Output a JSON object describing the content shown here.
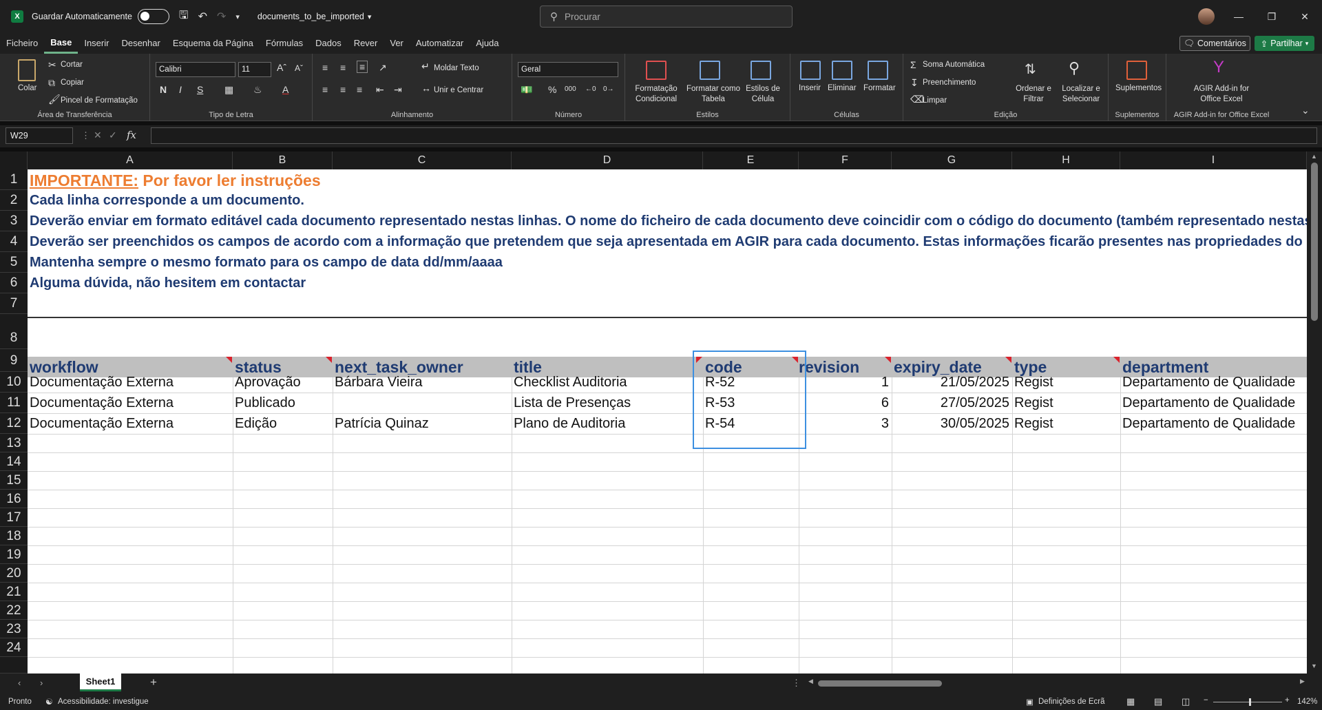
{
  "titlebar": {
    "autosave_label": "Guardar Automaticamente",
    "document_name": "documents_to_be_imported",
    "search_placeholder": "Procurar",
    "window_controls": [
      "minimize-icon",
      "restore-icon",
      "close-icon"
    ]
  },
  "menu": {
    "items": [
      "Ficheiro",
      "Base",
      "Inserir",
      "Desenhar",
      "Esquema da Página",
      "Fórmulas",
      "Dados",
      "Rever",
      "Ver",
      "Automatizar",
      "Ajuda"
    ],
    "active": "Base",
    "comments_label": "Comentários",
    "share_label": "Partilhar"
  },
  "ribbon": {
    "clipboard": {
      "paste": "Colar",
      "cut": "Cortar",
      "copy": "Copiar",
      "format_painter": "Pincel de Formatação",
      "group": "Área de Transferência"
    },
    "font": {
      "family": "Calibri",
      "size": "11",
      "bold": "N",
      "italic": "I",
      "underline": "S",
      "group": "Tipo de Letra"
    },
    "alignment": {
      "wrap": "Moldar Texto",
      "merge": "Unir e Centrar",
      "group": "Alinhamento"
    },
    "number": {
      "format": "Geral",
      "group": "Número"
    },
    "styles": {
      "conditional": "Formatação Condicional",
      "table": "Formatar como Tabela",
      "cell": "Estilos de Célula",
      "group": "Estilos"
    },
    "cells": {
      "insert": "Inserir",
      "delete": "Eliminar",
      "format": "Formatar",
      "group": "Células"
    },
    "editing": {
      "autosum": "Soma Automática",
      "fill": "Preenchimento",
      "clear": "Limpar",
      "sort": "Ordenar e Filtrar",
      "find": "Localizar e Selecionar",
      "group": "Edição"
    },
    "addins": {
      "label": "Suplementos",
      "group": "Suplementos"
    },
    "agir": {
      "label": "AGIR Add-in for Office Excel",
      "group": "AGIR Add-in for Office Excel"
    }
  },
  "formula_bar": {
    "name_box": "W29",
    "fx": "fx",
    "formula": ""
  },
  "sheet": {
    "columns": [
      "A",
      "B",
      "C",
      "D",
      "E",
      "F",
      "G",
      "H",
      "I"
    ],
    "rows": [
      "1",
      "2",
      "3",
      "4",
      "5",
      "6",
      "7",
      "8",
      "9",
      "10",
      "11",
      "12",
      "13",
      "14",
      "15",
      "16",
      "17",
      "18",
      "19",
      "20",
      "21",
      "22",
      "23",
      "24"
    ],
    "instructions": {
      "important": "IMPORTANTE:",
      "important_rest": " Por favor ler instruções",
      "r2": "Cada linha corresponde a um documento.",
      "r3": "Deverão enviar em formato editável cada documento representado nestas linhas. O nome do ficheiro de cada documento deve coincidir com o código do documento (também representado nestas",
      "r4": "Deverão ser preenchidos os campos de acordo com a informação que pretendem que seja apresentada em AGIR para cada documento. Estas informações ficarão presentes nas propriedades do doc",
      "r5": "Mantenha sempre o mesmo formato para os campo de data dd/mm/aaaa",
      "r6": "Alguma dúvida, não hesitem em contactar"
    },
    "headers": [
      "workflow",
      "status",
      "next_task_owner",
      "title",
      "code",
      "revision",
      "expiry_date",
      "type",
      "department"
    ],
    "data": [
      [
        "Documentação Externa",
        "Aprovação",
        "Bárbara Vieira",
        "Checklist Auditoria",
        "R-52",
        "1",
        "21/05/2025",
        "Regist",
        "Departamento de Qualidade"
      ],
      [
        "Documentação Externa",
        "Publicado",
        "",
        "Lista de Presenças",
        "R-53",
        "6",
        "27/05/2025",
        "Regist",
        "Departamento de Qualidade"
      ],
      [
        "Documentação Externa",
        "Edição",
        "Patrícia Quinaz",
        "Plano de Auditoria",
        "R-54",
        "3",
        "30/05/2025",
        "Regist",
        "Departamento de Qualidade"
      ]
    ],
    "tab": "Sheet1"
  },
  "status": {
    "ready": "Pronto",
    "accessibility": "Acessibilidade: investigue",
    "display_settings": "Definições de Ecrã",
    "zoom": "142%"
  },
  "colors": {
    "orange": "#ed7d31",
    "navy": "#1f3b72",
    "header_fill": "#bfbfbf",
    "selection": "#3c8fe0",
    "share_green": "#1d7a46"
  }
}
